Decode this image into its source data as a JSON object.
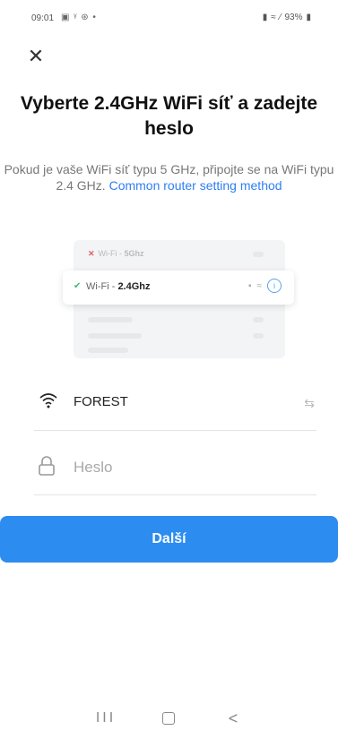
{
  "status_bar": {
    "time": "09:01",
    "left_icons": [
      "gallery-icon",
      "notification-icon",
      "sync-icon",
      "dot-icon"
    ],
    "right_icons": [
      "vibrate-icon",
      "wifi-icon",
      "signal-icon",
      "battery-icon"
    ],
    "battery": "93%"
  },
  "header": {
    "close_icon": "close-icon"
  },
  "content": {
    "title": "Vyberte 2.4GHz WiFi síť a zadejte heslo",
    "subtitle_text": "Pokud je vaše WiFi síť typu 5 GHz, připojte se na WiFi typu 2.4 GHz.",
    "subtitle_link": "Common router setting method"
  },
  "illustration": {
    "row_5g_prefix": "Wi-Fi - ",
    "row_5g_band": "5Ghz",
    "row_24_prefix": "Wi-Fi - ",
    "row_24_band": "2.4Ghz",
    "info_symbol": "i"
  },
  "form": {
    "ssid": "FOREST",
    "password_placeholder": "Heslo",
    "password_value": ""
  },
  "actions": {
    "next_label": "Další"
  },
  "navbar": {
    "recents": "III",
    "back": "<"
  },
  "colors": {
    "primary": "#2d8cf0",
    "link": "#2e7ef3",
    "check": "#3cb878",
    "error": "#e06060"
  }
}
